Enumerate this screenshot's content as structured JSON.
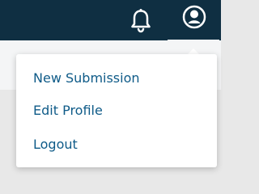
{
  "header": {
    "icons": {
      "notifications": "bell-icon",
      "account": "user-circle-icon"
    },
    "colors": {
      "bar": "#0f2f42",
      "icon": "#ffffff",
      "active_underline": "#ffffff"
    }
  },
  "account_menu": {
    "items": [
      {
        "label": "New Submission"
      },
      {
        "label": "Edit Profile"
      },
      {
        "label": "Logout"
      }
    ],
    "colors": {
      "link": "#0f5b88",
      "background": "#ffffff"
    }
  }
}
